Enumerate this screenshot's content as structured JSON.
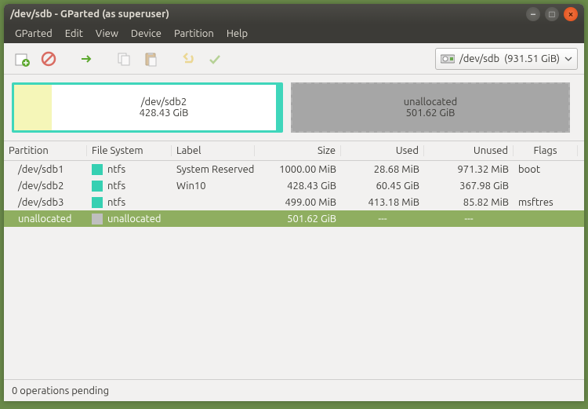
{
  "titlebar": {
    "title": "/dev/sdb - GParted (as superuser)"
  },
  "menubar": {
    "items": [
      "GParted",
      "Edit",
      "View",
      "Device",
      "Partition",
      "Help"
    ]
  },
  "device_selector": {
    "device": "/dev/sdb",
    "size": "(931.51 GiB)"
  },
  "chart": {
    "block_a": {
      "name": "/dev/sdb2",
      "size": "428.43 GiB"
    },
    "block_u": {
      "name": "unallocated",
      "size": "501.62 GiB"
    }
  },
  "table": {
    "headers": {
      "partition": "Partition",
      "filesystem": "File System",
      "label": "Label",
      "size": "Size",
      "used": "Used",
      "unused": "Unused",
      "flags": "Flags"
    },
    "rows": [
      {
        "partition": "/dev/sdb1",
        "fs": "ntfs",
        "fs_swatch": "s-ntfs",
        "label": "System Reserved",
        "size": "1000.00 MiB",
        "used": "28.68 MiB",
        "unused": "971.32 MiB",
        "flags": "boot",
        "selected": false
      },
      {
        "partition": "/dev/sdb2",
        "fs": "ntfs",
        "fs_swatch": "s-ntfs",
        "label": "Win10",
        "size": "428.43 GiB",
        "used": "60.45 GiB",
        "unused": "367.98 GiB",
        "flags": "",
        "selected": false
      },
      {
        "partition": "/dev/sdb3",
        "fs": "ntfs",
        "fs_swatch": "s-ntfs",
        "label": "",
        "size": "499.00 MiB",
        "used": "413.18 MiB",
        "unused": "85.82 MiB",
        "flags": "msftres",
        "selected": false
      },
      {
        "partition": "unallocated",
        "fs": "unallocated",
        "fs_swatch": "s-unalloc",
        "label": "",
        "size": "501.62 GiB",
        "used": "---",
        "unused": "---",
        "flags": "",
        "selected": true
      }
    ]
  },
  "status": {
    "text": "0 operations pending"
  }
}
